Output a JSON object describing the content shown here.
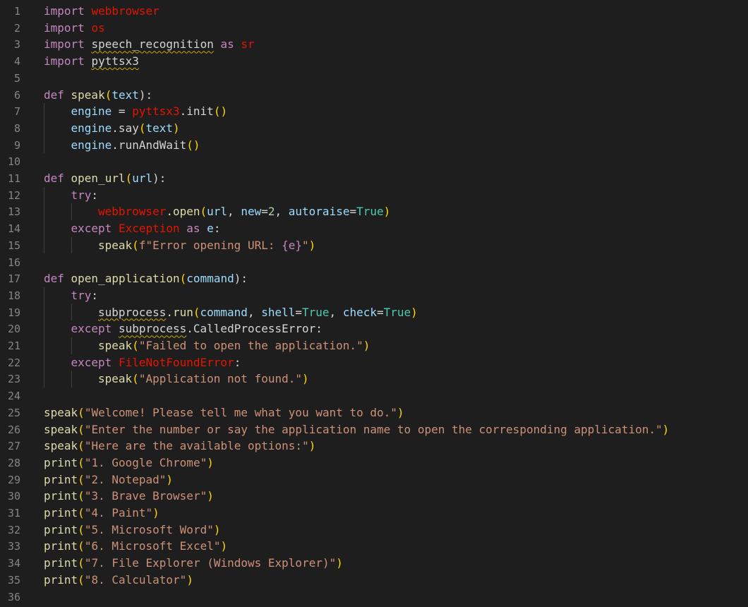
{
  "editor": {
    "language": "python",
    "colors": {
      "background": "#1e1e1e",
      "line_number": "#858585",
      "keyword": "#c586c0",
      "function": "#dcdcaa",
      "string": "#ce9178",
      "parameter": "#9cdcfe",
      "module": "#4ec9b0",
      "default": "#d4d4d4",
      "error_squiggle": "#cca700"
    },
    "lines": [
      [
        [
          "import ",
          "kw"
        ],
        [
          "webbrowser",
          "red"
        ]
      ],
      [
        [
          "import ",
          "kw"
        ],
        [
          "os",
          "red"
        ]
      ],
      [
        [
          "import ",
          "kw"
        ],
        [
          "speech_recognition",
          "plain",
          "sq"
        ],
        [
          " as ",
          "kw"
        ],
        [
          "sr",
          "red"
        ]
      ],
      [
        [
          "import ",
          "kw"
        ],
        [
          "pyttsx3",
          "plain",
          "sq"
        ]
      ],
      [],
      [
        [
          "def ",
          "kw"
        ],
        [
          "speak",
          "fn"
        ],
        [
          "(",
          "br"
        ],
        [
          "text",
          "param"
        ],
        ")",
        ":"
      ],
      [
        [
          "engine",
          "param"
        ],
        " = ",
        [
          "pyttsx3",
          "red"
        ],
        ".init",
        [
          "()",
          "br"
        ]
      ],
      [
        [
          "engine",
          "param"
        ],
        ".say",
        [
          "(",
          "br"
        ],
        [
          "text",
          "param"
        ],
        [
          ")",
          "br"
        ]
      ],
      [
        [
          "engine",
          "param"
        ],
        ".runAndWait",
        [
          "()",
          "br"
        ]
      ],
      [],
      [
        [
          "def ",
          "kw"
        ],
        [
          "open_url",
          "fn"
        ],
        [
          "(",
          "br"
        ],
        [
          "url",
          "param"
        ],
        ")",
        ":"
      ],
      [
        [
          "try",
          "kw"
        ],
        ":"
      ],
      [
        [
          "webbrowser",
          "red"
        ],
        [
          ".open",
          "fn"
        ],
        [
          "(",
          "br"
        ],
        [
          "url",
          "param"
        ],
        ", ",
        [
          "new",
          "param"
        ],
        "=",
        [
          "2",
          "num"
        ],
        ", ",
        [
          "autoraise",
          "param"
        ],
        "=",
        [
          "True",
          "bool"
        ],
        [
          ")",
          "br"
        ]
      ],
      [
        [
          "except ",
          "kw"
        ],
        [
          "Exception",
          "red"
        ],
        [
          " as ",
          "kw"
        ],
        [
          "e",
          "param"
        ],
        ":"
      ],
      [
        [
          "speak",
          "fn"
        ],
        [
          "(",
          "br"
        ],
        [
          "f\"Error opening URL: ",
          "str"
        ],
        [
          "{e}",
          "fstr"
        ],
        [
          "\"",
          "str"
        ],
        [
          ")",
          "br"
        ]
      ],
      [],
      [
        [
          "def ",
          "kw"
        ],
        [
          "open_application",
          "fn"
        ],
        [
          "(",
          "br"
        ],
        [
          "command",
          "param"
        ],
        ")",
        ":"
      ],
      [
        [
          "try",
          "kw"
        ],
        ":"
      ],
      [
        [
          "subprocess",
          "plain",
          "sq"
        ],
        [
          ".run",
          "fn"
        ],
        [
          "(",
          "br"
        ],
        [
          "command",
          "param"
        ],
        ", ",
        [
          "shell",
          "param"
        ],
        "=",
        [
          "True",
          "bool"
        ],
        ", ",
        [
          "check",
          "param"
        ],
        "=",
        [
          "True",
          "bool"
        ],
        [
          ")",
          "br"
        ]
      ],
      [
        [
          "except ",
          "kw"
        ],
        [
          "subprocess",
          "plain",
          "sq"
        ],
        ".CalledProcessError",
        ":"
      ],
      [
        [
          "speak",
          "fn"
        ],
        [
          "(",
          "br"
        ],
        [
          "\"Failed to open the application.\"",
          "str"
        ],
        [
          ")",
          "br"
        ]
      ],
      [
        [
          "except ",
          "kw"
        ],
        [
          "FileNotFoundError",
          "red"
        ],
        ":"
      ],
      [
        [
          "speak",
          "fn"
        ],
        [
          "(",
          "br"
        ],
        [
          "\"Application not found.\"",
          "str"
        ],
        [
          ")",
          "br"
        ]
      ],
      [],
      [
        [
          "speak",
          "fn"
        ],
        [
          "(",
          "br"
        ],
        [
          "\"Welcome! Please tell me what you want to do.\"",
          "str"
        ],
        [
          ")",
          "br"
        ]
      ],
      [
        [
          "speak",
          "fn"
        ],
        [
          "(",
          "br"
        ],
        [
          "\"Enter the number or say the application name to open the corresponding application.\"",
          "str"
        ],
        [
          ")",
          "br"
        ]
      ],
      [
        [
          "speak",
          "fn"
        ],
        [
          "(",
          "br"
        ],
        [
          "\"Here are the available options:\"",
          "str"
        ],
        [
          ")",
          "br"
        ]
      ],
      [
        [
          "print",
          "fn"
        ],
        [
          "(",
          "br"
        ],
        [
          "\"1. Google Chrome\"",
          "str"
        ],
        [
          ")",
          "br"
        ]
      ],
      [
        [
          "print",
          "fn"
        ],
        [
          "(",
          "br"
        ],
        [
          "\"2. Notepad\"",
          "str"
        ],
        [
          ")",
          "br"
        ]
      ],
      [
        [
          "print",
          "fn"
        ],
        [
          "(",
          "br"
        ],
        [
          "\"3. Brave Browser\"",
          "str"
        ],
        [
          ")",
          "br"
        ]
      ],
      [
        [
          "print",
          "fn"
        ],
        [
          "(",
          "br"
        ],
        [
          "\"4. Paint\"",
          "str"
        ],
        [
          ")",
          "br"
        ]
      ],
      [
        [
          "print",
          "fn"
        ],
        [
          "(",
          "br"
        ],
        [
          "\"5. Microsoft Word\"",
          "str"
        ],
        [
          ")",
          "br"
        ]
      ],
      [
        [
          "print",
          "fn"
        ],
        [
          "(",
          "br"
        ],
        [
          "\"6. Microsoft Excel\"",
          "str"
        ],
        [
          ")",
          "br"
        ]
      ],
      [
        [
          "print",
          "fn"
        ],
        [
          "(",
          "br"
        ],
        [
          "\"7. File Explorer (Windows Explorer)\"",
          "str"
        ],
        [
          ")",
          "br"
        ]
      ],
      [
        [
          "print",
          "fn"
        ],
        [
          "(",
          "br"
        ],
        [
          "\"8. Calculator\"",
          "str"
        ],
        [
          ")",
          "br"
        ]
      ],
      []
    ]
  }
}
